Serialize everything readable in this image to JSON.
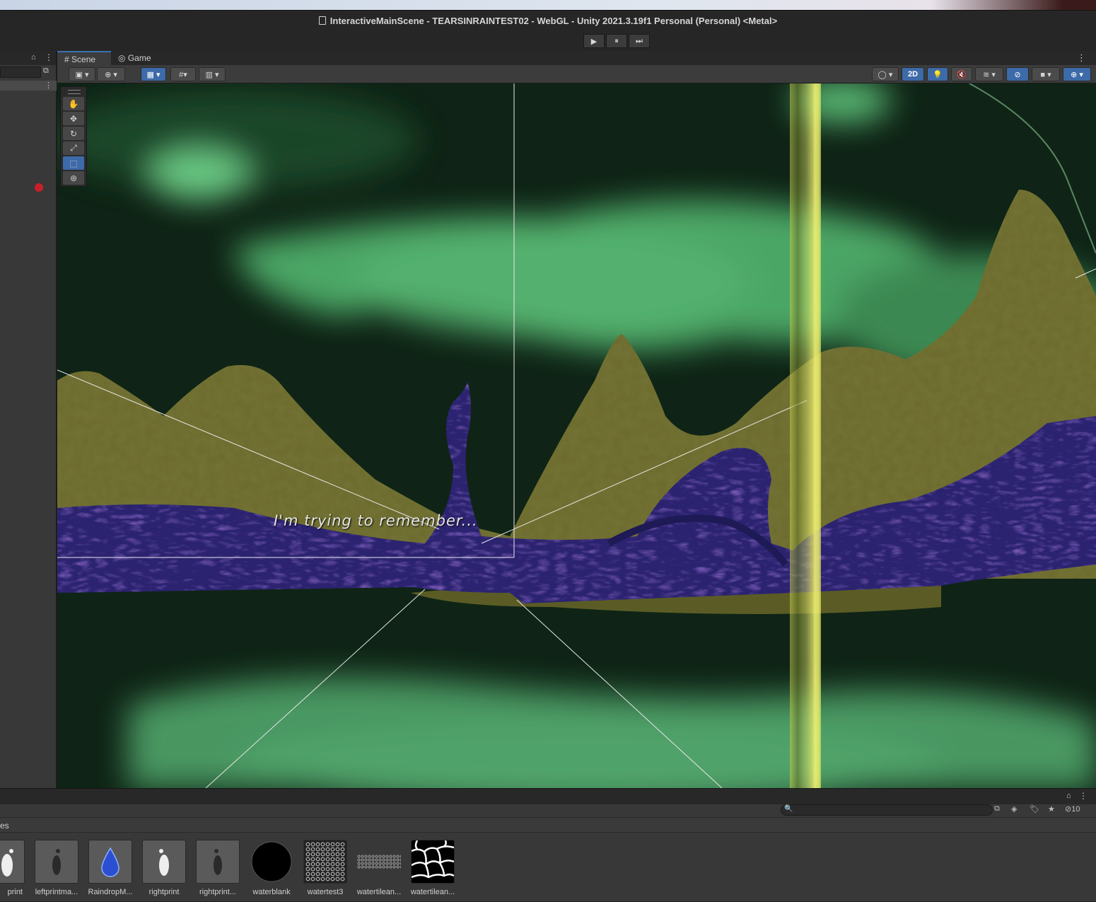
{
  "window": {
    "title": "InteractiveMainScene - TEARSINRAINTEST02 - WebGL - Unity 2021.3.19f1 Personal (Personal) <Metal>"
  },
  "playbar": {
    "play": "▶",
    "pause": "⏸",
    "step": "⏭"
  },
  "tabs": [
    {
      "label": "Scene",
      "icon": "hash-icon"
    },
    {
      "label": "Game",
      "icon": "gamepad-icon"
    }
  ],
  "toolbar": {
    "mode_2d": "2D"
  },
  "scene": {
    "subtitle": "I'm trying to remember..."
  },
  "project": {
    "breadcrumb": "es",
    "hidden_count": "10",
    "search_placeholder": "",
    "assets": [
      {
        "name": "print",
        "type": "footprint-left"
      },
      {
        "name": "leftprintma...",
        "type": "footprint-dark"
      },
      {
        "name": "RaindropM...",
        "type": "raindrop"
      },
      {
        "name": "rightprint",
        "type": "footprint-right"
      },
      {
        "name": "rightprint...",
        "type": "footprint-dark"
      },
      {
        "name": "waterblank",
        "type": "black-circle"
      },
      {
        "name": "watertest3",
        "type": "cell-texture"
      },
      {
        "name": "watertilean...",
        "type": "strip-texture"
      },
      {
        "name": "watertilean...",
        "type": "voronoi-texture"
      }
    ]
  },
  "colors": {
    "accent": "#3d6aa8",
    "sky_green": "#6fd38a",
    "ground_olive": "#6b6a2c",
    "river_purple": "#2b2370",
    "beam_yellow": "#e8f060"
  }
}
